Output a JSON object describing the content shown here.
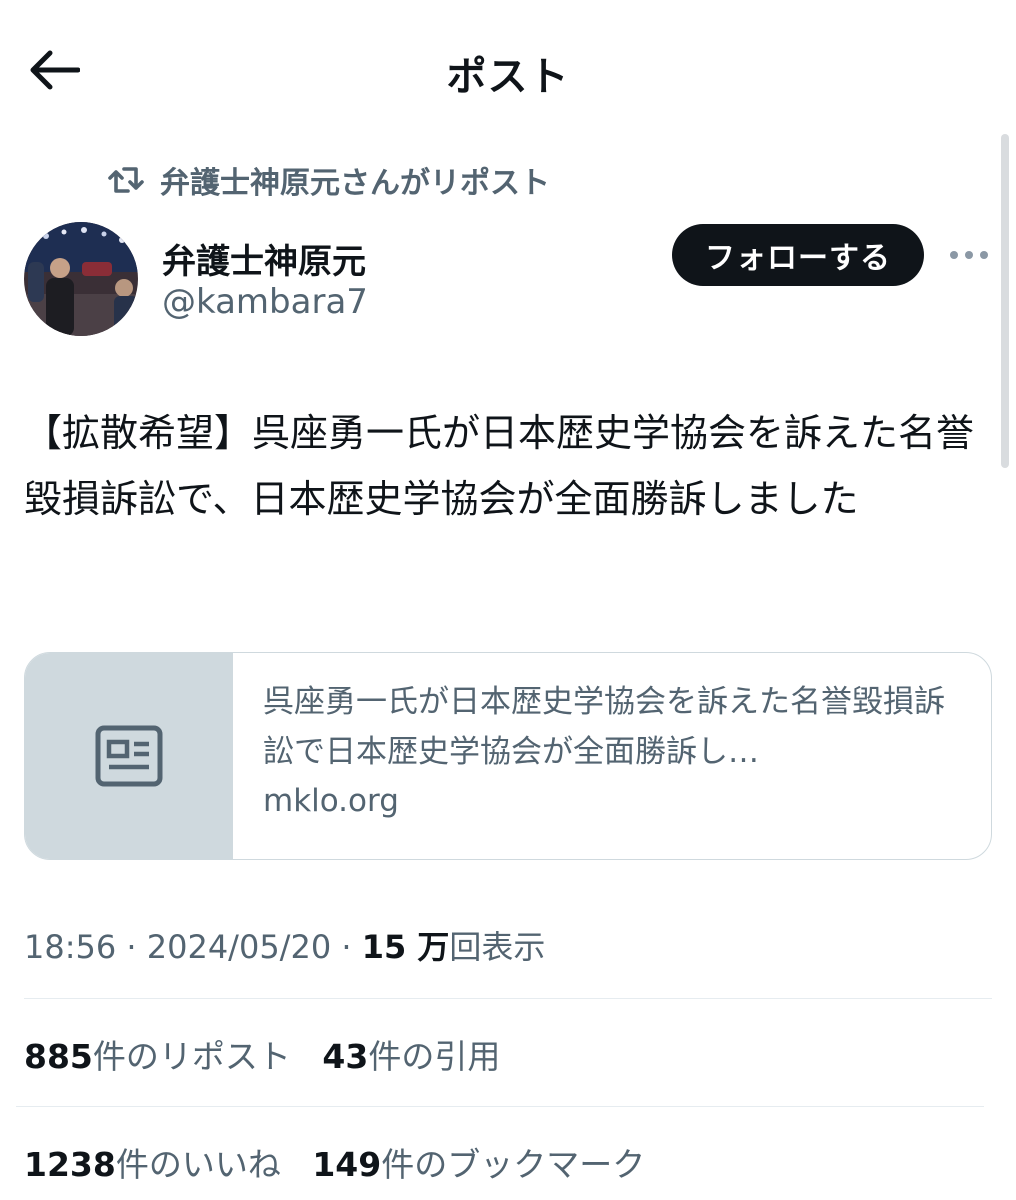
{
  "header": {
    "title": "ポスト"
  },
  "repost_context": {
    "text": "弁護士神原元さんがリポスト"
  },
  "author": {
    "name": "弁護士神原元",
    "handle": "@kambara7"
  },
  "follow_button": {
    "label": "フォローする"
  },
  "post": {
    "text": "【拡散希望】呉座勇一氏が日本歴史学協会を訴えた名誉毀損訴訟で、日本歴史学協会が全面勝訴しました"
  },
  "link_card": {
    "title": "呉座勇一氏が日本歴史学協会を訴えた名誉毀損訴訟で日本歴史学協会が全面勝訴し…",
    "domain": "mklo.org"
  },
  "meta": {
    "time": "18:56",
    "separator": "·",
    "date": "2024/05/20",
    "views_count": "15 万",
    "views_label": "回表示"
  },
  "stats": {
    "reposts": {
      "count": "885",
      "label": "件のリポスト"
    },
    "quotes": {
      "count": "43",
      "label": "件の引用"
    },
    "likes": {
      "count": "1238",
      "label": "件のいいね"
    },
    "bookmarks": {
      "count": "149",
      "label": "件のブックマーク"
    }
  },
  "icons": {
    "back": "arrow-left-icon",
    "repost": "repost-icon",
    "more": "more-dots-icon",
    "article": "article-icon"
  },
  "colors": {
    "text_primary": "#0f1419",
    "text_secondary": "#536471",
    "follow_button_bg": "#0f1419",
    "card_thumb_bg": "#cfd9de",
    "border": "#cfd9de"
  }
}
